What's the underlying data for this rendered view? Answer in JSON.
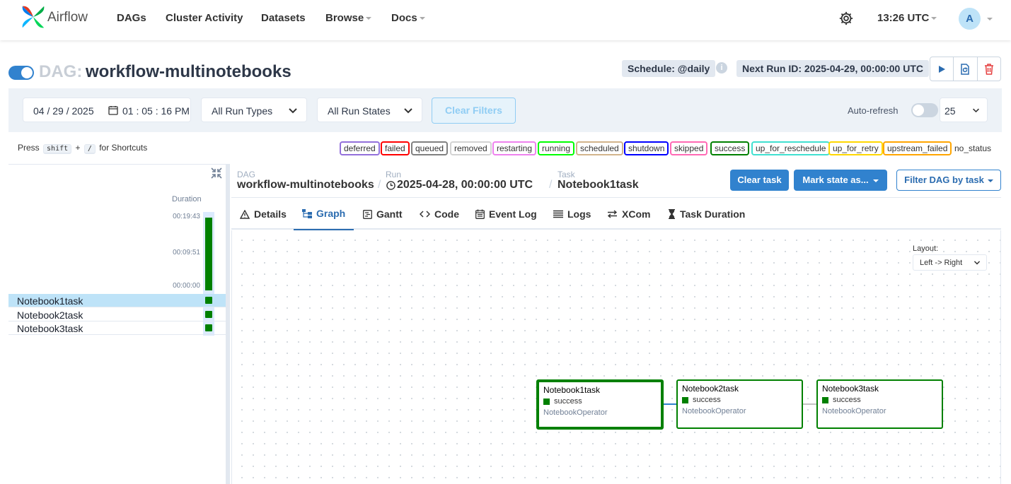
{
  "nav": {
    "brand": "Airflow",
    "links": [
      "DAGs",
      "Cluster Activity",
      "Datasets",
      "Browse",
      "Docs"
    ],
    "clock": "13:26 UTC",
    "avatar": "A"
  },
  "header": {
    "dag_prefix": "DAG:",
    "dag_id": "workflow-multinotebooks",
    "schedule": "Schedule: @daily",
    "next_run": "Next Run ID: 2025-04-29, 00:00:00 UTC"
  },
  "filters": {
    "datetime": "04 / 29 / 2025 \u0001 01 : 05 : 16   PM",
    "date": "04 / 29 / 2025",
    "time": "01 : 05 : 16   PM",
    "run_types": "All Run Types",
    "run_states": "All Run States",
    "clear": "Clear Filters",
    "auto_refresh": "Auto-refresh",
    "page_size": "25"
  },
  "shortcuts": {
    "press": "Press",
    "key1": "shift",
    "plus": "+",
    "key2": "/",
    "suffix": "for Shortcuts"
  },
  "legend": [
    {
      "label": "deferred",
      "color": "#9370db"
    },
    {
      "label": "failed",
      "color": "#ff0000"
    },
    {
      "label": "queued",
      "color": "#808080"
    },
    {
      "label": "removed",
      "color": "#d3d3d3"
    },
    {
      "label": "restarting",
      "color": "#ee82ee"
    },
    {
      "label": "running",
      "color": "#00ff00"
    },
    {
      "label": "scheduled",
      "color": "#d2b48c"
    },
    {
      "label": "shutdown",
      "color": "#0000ff"
    },
    {
      "label": "skipped",
      "color": "#ff69b4"
    },
    {
      "label": "success",
      "color": "#008000"
    },
    {
      "label": "up_for_reschedule",
      "color": "#40e0d0"
    },
    {
      "label": "up_for_retry",
      "color": "#ffd700"
    },
    {
      "label": "upstream_failed",
      "color": "#ffa500"
    },
    {
      "label": "no_status",
      "color": null
    }
  ],
  "grid": {
    "duration_label": "Duration",
    "ticks": [
      "00:19:43",
      "00:09:51",
      "00:00:00"
    ],
    "tasks": [
      "Notebook1task",
      "Notebook2task",
      "Notebook3task"
    ]
  },
  "breadcrumb": {
    "dag_label": "DAG",
    "dag_value": "workflow-multinotebooks",
    "run_label": "Run",
    "run_value": "2025-04-28, 00:00:00 UTC",
    "task_label": "Task",
    "task_value": "Notebook1task"
  },
  "actions": {
    "clear_task": "Clear task",
    "mark_state": "Mark state as...",
    "filter_dag": "Filter DAG by task"
  },
  "tabs": [
    "Details",
    "Graph",
    "Gantt",
    "Code",
    "Event Log",
    "Logs",
    "XCom",
    "Task Duration"
  ],
  "graph": {
    "layout_label": "Layout:",
    "layout_value": "Left -> Right",
    "nodes": [
      {
        "name": "Notebook1task",
        "state": "success",
        "operator": "NotebookOperator"
      },
      {
        "name": "Notebook2task",
        "state": "success",
        "operator": "NotebookOperator"
      },
      {
        "name": "Notebook3task",
        "state": "success",
        "operator": "NotebookOperator"
      }
    ]
  },
  "colors": {
    "accent": "#3182ce",
    "success": "#008000"
  }
}
